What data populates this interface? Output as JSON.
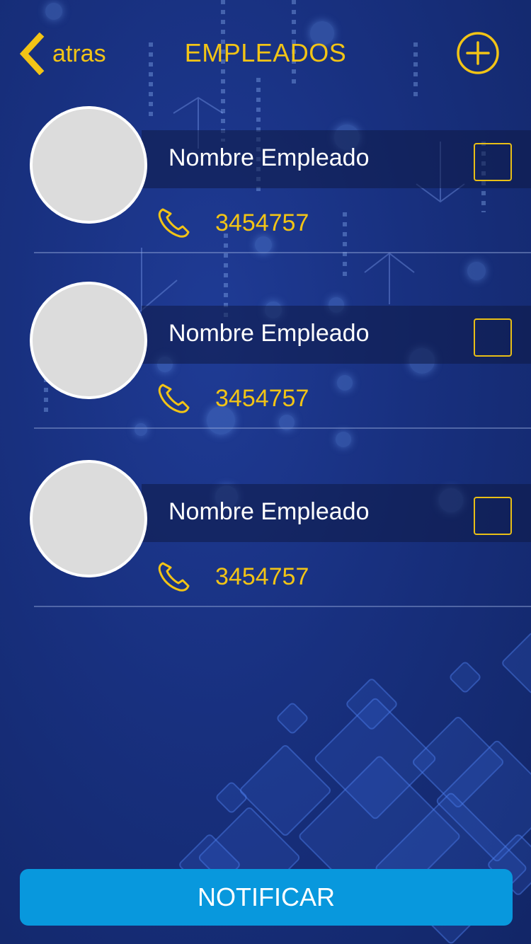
{
  "header": {
    "back_label": "atras",
    "title": "EMPLEADOS",
    "back_icon": "chevron-left-icon",
    "add_icon": "plus-circle-icon"
  },
  "employees": [
    {
      "name": "Nombre Empleado",
      "phone": "3454757",
      "selected": false
    },
    {
      "name": "Nombre Empleado",
      "phone": "3454757",
      "selected": false
    },
    {
      "name": "Nombre Empleado",
      "phone": "3454757",
      "selected": false
    }
  ],
  "footer": {
    "notify_label": "NOTIFICAR"
  },
  "colors": {
    "accent": "#f2c416",
    "button": "#0898dd",
    "background": "#18307f",
    "avatar": "#dcdcdc"
  }
}
